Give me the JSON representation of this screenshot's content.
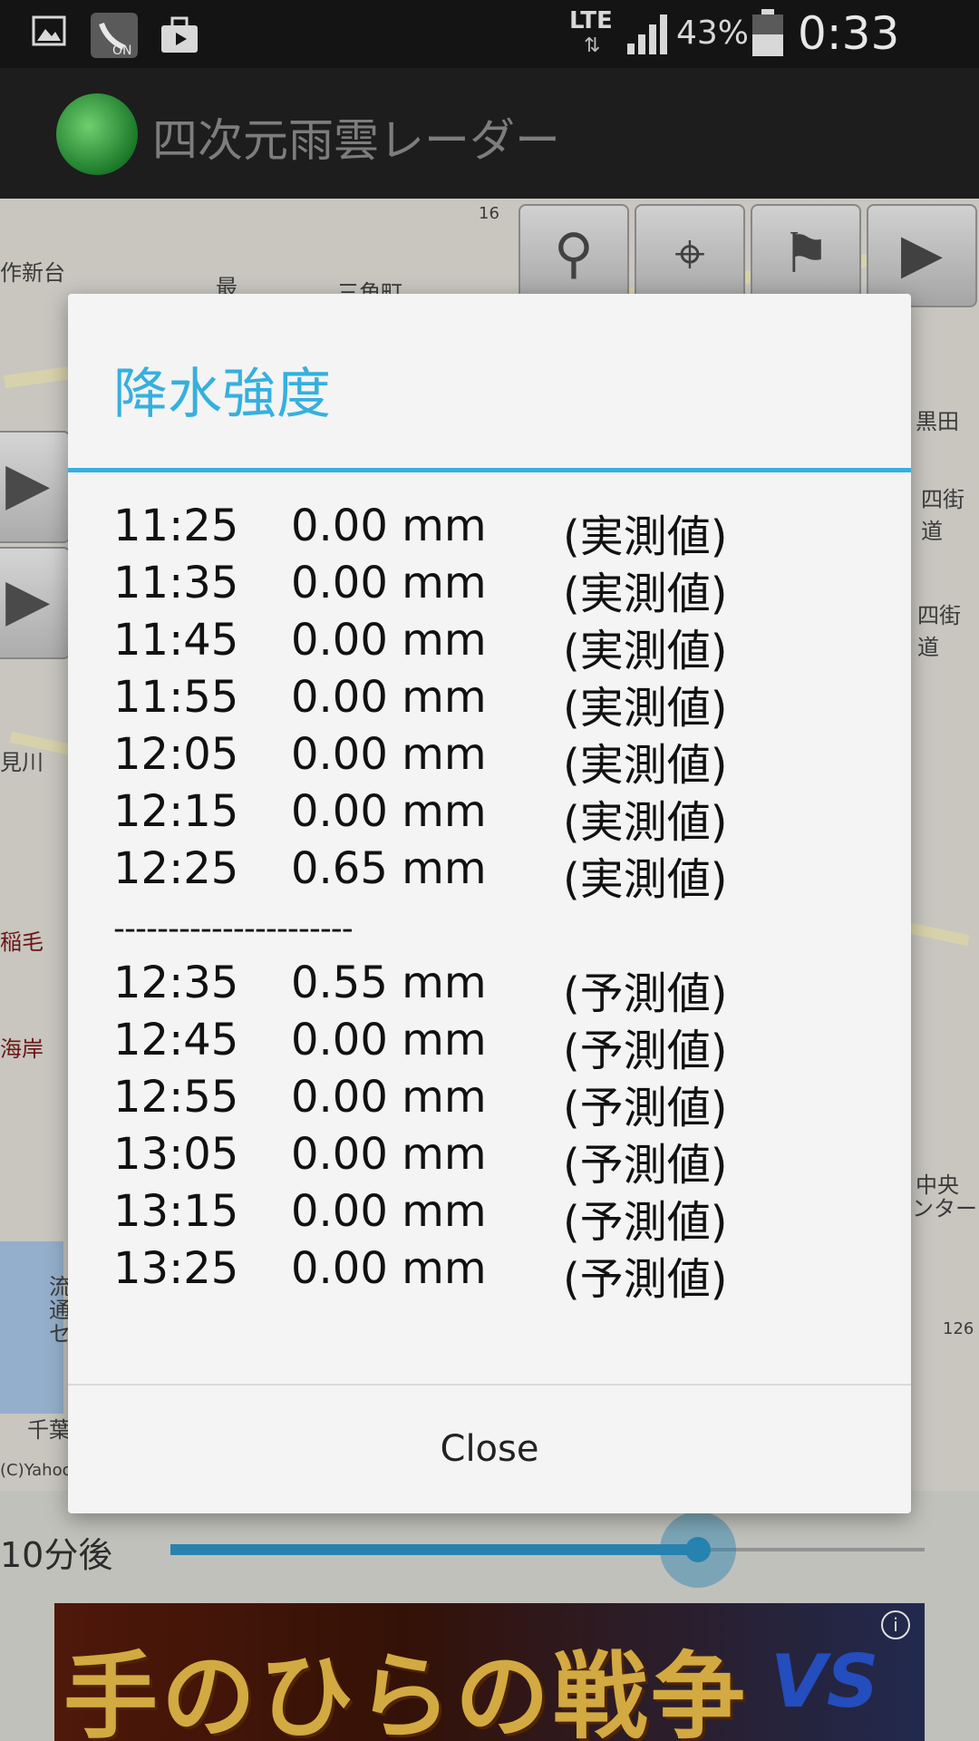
{
  "status_bar": {
    "network": "LTE",
    "battery_percent": "43%",
    "time": "0:33 PM",
    "icons": [
      "image-icon",
      "wifi-calling-icon",
      "briefcase-icon",
      "signal-icon",
      "battery-icon"
    ]
  },
  "app_bar": {
    "title": "四次元雨雲レーダー"
  },
  "map": {
    "labels": [
      "作新台",
      "三角町",
      "最",
      "見川",
      "稲毛",
      "海岸",
      "四街道",
      "四街道",
      "黒田",
      "中央",
      "ンター",
      "千葉",
      "流",
      "通",
      "セ",
      "(C)Yahoo"
    ],
    "route_numbers": [
      "16",
      "126"
    ],
    "toolbar_icons": [
      "map-pin-icon",
      "crosshair-icon",
      "person-flag-icon",
      "film-icon"
    ],
    "side_icons": [
      "play-icon",
      "play-icon"
    ]
  },
  "slider": {
    "label": "10分後",
    "progress_fraction": 0.7
  },
  "ad": {
    "text": "手のひらの戦争",
    "vs": "VS",
    "info": "i"
  },
  "dialog": {
    "title": "降水強度",
    "observed_rows": [
      {
        "time": "11:25",
        "value": "0.00 mm",
        "note": "(実測値)"
      },
      {
        "time": "11:35",
        "value": "0.00 mm",
        "note": "(実測値)"
      },
      {
        "time": "11:45",
        "value": "0.00 mm",
        "note": "(実測値)"
      },
      {
        "time": "11:55",
        "value": "0.00 mm",
        "note": "(実測値)"
      },
      {
        "time": "12:05",
        "value": "0.00 mm",
        "note": "(実測値)"
      },
      {
        "time": "12:15",
        "value": "0.00 mm",
        "note": "(実測値)"
      },
      {
        "time": "12:25",
        "value": "0.65 mm",
        "note": "(実測値)"
      }
    ],
    "separator": "----------------------",
    "forecast_rows": [
      {
        "time": "12:35",
        "value": "0.55 mm",
        "note": "(予測値)"
      },
      {
        "time": "12:45",
        "value": "0.00 mm",
        "note": "(予測値)"
      },
      {
        "time": "12:55",
        "value": "0.00 mm",
        "note": "(予測値)"
      },
      {
        "time": "13:05",
        "value": "0.00 mm",
        "note": "(予測値)"
      },
      {
        "time": "13:15",
        "value": "0.00 mm",
        "note": "(予測値)"
      },
      {
        "time": "13:25",
        "value": "0.00 mm",
        "note": "(予測値)"
      }
    ],
    "close_label": "Close"
  }
}
